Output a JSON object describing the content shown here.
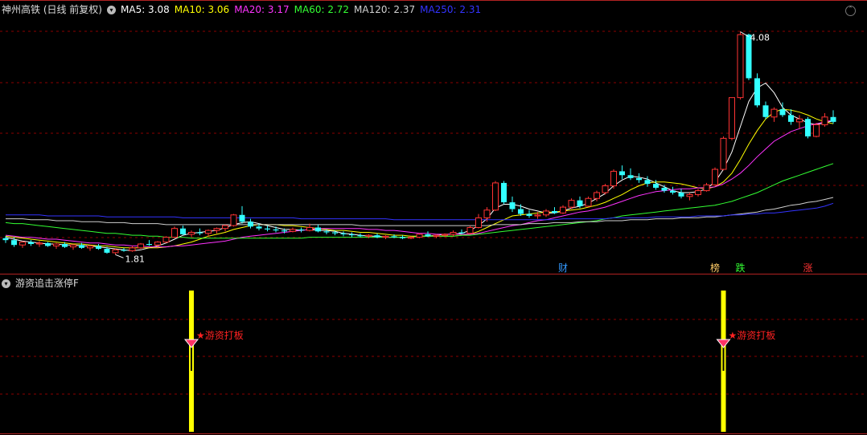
{
  "header": {
    "stock_title": "神州高铁 (日线 前复权)",
    "ma_items": [
      {
        "label": "MA5: 3.08",
        "color": "#ffffff"
      },
      {
        "label": "MA10: 3.06",
        "color": "#ffff00"
      },
      {
        "label": "MA20: 3.17",
        "color": "#ff33ff"
      },
      {
        "label": "MA60: 2.72",
        "color": "#33ff33"
      },
      {
        "label": "MA120: 2.37",
        "color": "#d0d0d0"
      },
      {
        "label": "MA250: 2.31",
        "color": "#3333ff"
      }
    ]
  },
  "sub_header": {
    "indicator_title": "游资追击涨停F"
  },
  "chart_data": {
    "type": "candlestick",
    "ylim": [
      1.65,
      4.2
    ],
    "candles": [
      [
        1.95,
        1.97,
        1.9,
        1.93
      ],
      [
        1.93,
        1.96,
        1.86,
        1.88
      ],
      [
        1.88,
        1.92,
        1.85,
        1.91
      ],
      [
        1.91,
        1.93,
        1.87,
        1.89
      ],
      [
        1.89,
        1.92,
        1.86,
        1.9
      ],
      [
        1.9,
        1.91,
        1.86,
        1.87
      ],
      [
        1.87,
        1.9,
        1.84,
        1.89
      ],
      [
        1.89,
        1.91,
        1.85,
        1.86
      ],
      [
        1.86,
        1.89,
        1.83,
        1.88
      ],
      [
        1.88,
        1.9,
        1.84,
        1.85
      ],
      [
        1.85,
        1.88,
        1.82,
        1.87
      ],
      [
        1.87,
        1.89,
        1.83,
        1.84
      ],
      [
        1.84,
        1.86,
        1.79,
        1.8
      ],
      [
        1.8,
        1.84,
        1.78,
        1.83
      ],
      [
        1.83,
        1.85,
        1.81,
        1.82
      ],
      [
        1.82,
        1.87,
        1.81,
        1.85
      ],
      [
        1.85,
        1.9,
        1.84,
        1.89
      ],
      [
        1.89,
        1.93,
        1.87,
        1.88
      ],
      [
        1.88,
        1.92,
        1.86,
        1.91
      ],
      [
        1.91,
        1.97,
        1.9,
        1.96
      ],
      [
        1.96,
        2.07,
        1.95,
        2.05
      ],
      [
        2.05,
        2.08,
        1.98,
        1.99
      ],
      [
        1.99,
        2.03,
        1.96,
        2.01
      ],
      [
        2.01,
        2.05,
        1.98,
        2.0
      ],
      [
        2.0,
        2.04,
        1.97,
        2.03
      ],
      [
        2.03,
        2.06,
        2.0,
        2.05
      ],
      [
        2.05,
        2.09,
        2.02,
        2.08
      ],
      [
        2.08,
        2.2,
        2.07,
        2.19
      ],
      [
        2.19,
        2.28,
        2.1,
        2.12
      ],
      [
        2.12,
        2.15,
        2.05,
        2.07
      ],
      [
        2.07,
        2.1,
        2.03,
        2.05
      ],
      [
        2.05,
        2.08,
        2.02,
        2.04
      ],
      [
        2.04,
        2.07,
        2.01,
        2.03
      ],
      [
        2.03,
        2.05,
        2.0,
        2.02
      ],
      [
        2.02,
        2.06,
        2.01,
        2.04
      ],
      [
        2.04,
        2.06,
        2.01,
        2.03
      ],
      [
        2.03,
        2.1,
        2.02,
        2.06
      ],
      [
        2.06,
        2.09,
        2.01,
        2.02
      ],
      [
        2.02,
        2.04,
        1.99,
        2.01
      ],
      [
        2.01,
        2.03,
        1.98,
        2.0
      ],
      [
        2.0,
        2.02,
        1.97,
        1.99
      ],
      [
        1.99,
        2.01,
        1.96,
        1.98
      ],
      [
        1.98,
        2.0,
        1.96,
        1.97
      ],
      [
        1.97,
        1.99,
        1.95,
        1.98
      ],
      [
        1.98,
        2.0,
        1.95,
        1.96
      ],
      [
        1.96,
        1.98,
        1.94,
        1.97
      ],
      [
        1.97,
        1.99,
        1.95,
        1.96
      ],
      [
        1.96,
        1.98,
        1.94,
        1.95
      ],
      [
        1.95,
        1.97,
        1.94,
        1.96
      ],
      [
        1.96,
        2.0,
        1.95,
        1.99
      ],
      [
        1.99,
        2.02,
        1.96,
        1.97
      ],
      [
        1.97,
        1.99,
        1.95,
        1.98
      ],
      [
        1.98,
        2.0,
        1.96,
        1.99
      ],
      [
        1.99,
        2.03,
        1.97,
        2.01
      ],
      [
        2.01,
        2.04,
        1.99,
        2.0
      ],
      [
        2.0,
        2.08,
        1.99,
        2.06
      ],
      [
        2.06,
        2.2,
        2.05,
        2.16
      ],
      [
        2.16,
        2.27,
        2.12,
        2.24
      ],
      [
        2.24,
        2.54,
        2.23,
        2.52
      ],
      [
        2.52,
        2.54,
        2.3,
        2.32
      ],
      [
        2.32,
        2.38,
        2.22,
        2.25
      ],
      [
        2.25,
        2.3,
        2.18,
        2.2
      ],
      [
        2.2,
        2.24,
        2.16,
        2.18
      ],
      [
        2.18,
        2.22,
        2.15,
        2.19
      ],
      [
        2.19,
        2.25,
        2.17,
        2.23
      ],
      [
        2.23,
        2.27,
        2.2,
        2.21
      ],
      [
        2.21,
        2.29,
        2.2,
        2.27
      ],
      [
        2.27,
        2.36,
        2.25,
        2.34
      ],
      [
        2.34,
        2.38,
        2.26,
        2.28
      ],
      [
        2.28,
        2.38,
        2.27,
        2.36
      ],
      [
        2.36,
        2.44,
        2.33,
        2.42
      ],
      [
        2.42,
        2.51,
        2.4,
        2.49
      ],
      [
        2.49,
        2.66,
        2.46,
        2.64
      ],
      [
        2.64,
        2.7,
        2.56,
        2.6
      ],
      [
        2.6,
        2.67,
        2.55,
        2.57
      ],
      [
        2.57,
        2.62,
        2.52,
        2.55
      ],
      [
        2.55,
        2.59,
        2.48,
        2.51
      ],
      [
        2.51,
        2.55,
        2.45,
        2.47
      ],
      [
        2.47,
        2.5,
        2.42,
        2.44
      ],
      [
        2.44,
        2.48,
        2.4,
        2.42
      ],
      [
        2.42,
        2.46,
        2.36,
        2.38
      ],
      [
        2.38,
        2.42,
        2.34,
        2.4
      ],
      [
        2.4,
        2.46,
        2.38,
        2.44
      ],
      [
        2.44,
        2.52,
        2.43,
        2.5
      ],
      [
        2.5,
        2.68,
        2.49,
        2.66
      ],
      [
        2.66,
        3.0,
        2.65,
        2.98
      ],
      [
        2.98,
        3.1,
        2.96,
        3.4
      ],
      [
        3.4,
        4.08,
        3.38,
        4.05
      ],
      [
        4.05,
        4.06,
        3.58,
        3.6
      ],
      [
        3.6,
        3.65,
        3.3,
        3.32
      ],
      [
        3.32,
        3.36,
        3.18,
        3.2
      ],
      [
        3.2,
        3.3,
        3.15,
        3.28
      ],
      [
        3.28,
        3.35,
        3.2,
        3.22
      ],
      [
        3.22,
        3.28,
        3.12,
        3.15
      ],
      [
        3.15,
        3.22,
        3.08,
        3.18
      ],
      [
        3.18,
        3.2,
        2.98,
        3.0
      ],
      [
        3.0,
        3.14,
        2.99,
        3.12
      ],
      [
        3.12,
        3.24,
        3.1,
        3.2
      ],
      [
        3.2,
        3.27,
        3.13,
        3.15
      ]
    ],
    "ma": [
      {
        "name": "MA5",
        "color": "#ffffff",
        "values": [
          1.96,
          1.94,
          1.92,
          1.91,
          1.9,
          1.89,
          1.89,
          1.88,
          1.88,
          1.87,
          1.87,
          1.86,
          1.85,
          1.84,
          1.83,
          1.82,
          1.83,
          1.85,
          1.87,
          1.9,
          1.94,
          1.98,
          2.0,
          2.01,
          2.02,
          2.03,
          2.06,
          2.09,
          2.11,
          2.12,
          2.1,
          2.08,
          2.06,
          2.04,
          2.04,
          2.03,
          2.04,
          2.03,
          2.03,
          2.02,
          2.0,
          1.99,
          1.98,
          1.97,
          1.97,
          1.96,
          1.96,
          1.96,
          1.96,
          1.97,
          1.97,
          1.98,
          1.99,
          1.99,
          2.0,
          2.03,
          2.08,
          2.15,
          2.26,
          2.3,
          2.3,
          2.28,
          2.25,
          2.23,
          2.21,
          2.21,
          2.23,
          2.26,
          2.28,
          2.31,
          2.36,
          2.41,
          2.49,
          2.55,
          2.59,
          2.58,
          2.56,
          2.52,
          2.48,
          2.44,
          2.42,
          2.42,
          2.43,
          2.46,
          2.53,
          2.66,
          2.84,
          3.1,
          3.36,
          3.5,
          3.55,
          3.45,
          3.3,
          3.22,
          3.18,
          3.14,
          3.12,
          3.14,
          3.16
        ]
      },
      {
        "name": "MA10",
        "color": "#ffff00",
        "values": [
          1.97,
          1.96,
          1.95,
          1.94,
          1.93,
          1.92,
          1.91,
          1.9,
          1.89,
          1.89,
          1.88,
          1.87,
          1.87,
          1.86,
          1.85,
          1.85,
          1.85,
          1.85,
          1.85,
          1.86,
          1.87,
          1.89,
          1.91,
          1.94,
          1.97,
          1.99,
          2.01,
          2.04,
          2.06,
          2.08,
          2.09,
          2.09,
          2.09,
          2.08,
          2.08,
          2.07,
          2.06,
          2.05,
          2.04,
          2.03,
          2.03,
          2.02,
          2.01,
          2.01,
          2.0,
          1.99,
          1.98,
          1.98,
          1.97,
          1.97,
          1.97,
          1.97,
          1.97,
          1.97,
          1.98,
          1.99,
          2.02,
          2.06,
          2.1,
          2.14,
          2.18,
          2.19,
          2.2,
          2.21,
          2.22,
          2.22,
          2.23,
          2.24,
          2.25,
          2.27,
          2.29,
          2.32,
          2.36,
          2.4,
          2.45,
          2.49,
          2.52,
          2.53,
          2.53,
          2.52,
          2.51,
          2.49,
          2.47,
          2.46,
          2.48,
          2.53,
          2.62,
          2.76,
          2.92,
          3.06,
          3.18,
          3.25,
          3.28,
          3.27,
          3.25,
          3.22,
          3.18,
          3.15,
          3.13
        ]
      },
      {
        "name": "MA20",
        "color": "#ff33ff",
        "values": [
          1.98,
          1.97,
          1.96,
          1.96,
          1.95,
          1.94,
          1.94,
          1.93,
          1.92,
          1.91,
          1.9,
          1.9,
          1.89,
          1.88,
          1.88,
          1.87,
          1.87,
          1.86,
          1.86,
          1.86,
          1.87,
          1.87,
          1.88,
          1.89,
          1.9,
          1.91,
          1.92,
          1.94,
          1.96,
          1.97,
          1.98,
          1.99,
          2.0,
          2.01,
          2.02,
          2.03,
          2.04,
          2.05,
          2.05,
          2.05,
          2.05,
          2.05,
          2.05,
          2.04,
          2.04,
          2.03,
          2.03,
          2.02,
          2.01,
          2.0,
          2.0,
          1.99,
          1.99,
          1.99,
          1.99,
          1.99,
          2.0,
          2.02,
          2.04,
          2.06,
          2.08,
          2.09,
          2.11,
          2.13,
          2.14,
          2.16,
          2.18,
          2.2,
          2.22,
          2.23,
          2.25,
          2.27,
          2.3,
          2.33,
          2.36,
          2.39,
          2.41,
          2.43,
          2.44,
          2.45,
          2.46,
          2.46,
          2.47,
          2.47,
          2.48,
          2.51,
          2.56,
          2.62,
          2.7,
          2.79,
          2.87,
          2.95,
          3.0,
          3.05,
          3.08,
          3.11,
          3.13,
          3.15,
          3.17
        ]
      },
      {
        "name": "MA60",
        "color": "#33ff33",
        "values": [
          2.11,
          2.1,
          2.1,
          2.09,
          2.08,
          2.07,
          2.06,
          2.05,
          2.04,
          2.03,
          2.02,
          2.01,
          2.0,
          2.0,
          1.99,
          1.98,
          1.98,
          1.97,
          1.97,
          1.96,
          1.96,
          1.96,
          1.95,
          1.95,
          1.95,
          1.95,
          1.95,
          1.95,
          1.95,
          1.95,
          1.95,
          1.95,
          1.95,
          1.95,
          1.95,
          1.95,
          1.96,
          1.96,
          1.96,
          1.96,
          1.96,
          1.96,
          1.96,
          1.96,
          1.96,
          1.96,
          1.96,
          1.96,
          1.96,
          1.97,
          1.97,
          1.97,
          1.97,
          1.97,
          1.98,
          1.98,
          1.99,
          2.0,
          2.01,
          2.02,
          2.03,
          2.04,
          2.05,
          2.06,
          2.07,
          2.08,
          2.09,
          2.1,
          2.11,
          2.12,
          2.13,
          2.15,
          2.16,
          2.18,
          2.19,
          2.2,
          2.21,
          2.22,
          2.23,
          2.24,
          2.25,
          2.26,
          2.27,
          2.28,
          2.29,
          2.31,
          2.33,
          2.36,
          2.39,
          2.42,
          2.46,
          2.5,
          2.54,
          2.57,
          2.6,
          2.63,
          2.66,
          2.69,
          2.72
        ]
      },
      {
        "name": "MA120",
        "color": "#d0d0d0",
        "values": [
          2.15,
          2.15,
          2.15,
          2.14,
          2.14,
          2.14,
          2.13,
          2.13,
          2.13,
          2.12,
          2.12,
          2.12,
          2.11,
          2.11,
          2.11,
          2.1,
          2.1,
          2.1,
          2.1,
          2.09,
          2.09,
          2.09,
          2.09,
          2.09,
          2.09,
          2.09,
          2.09,
          2.09,
          2.09,
          2.09,
          2.09,
          2.09,
          2.09,
          2.09,
          2.09,
          2.09,
          2.09,
          2.09,
          2.09,
          2.09,
          2.09,
          2.09,
          2.08,
          2.08,
          2.08,
          2.08,
          2.08,
          2.08,
          2.08,
          2.08,
          2.08,
          2.08,
          2.08,
          2.08,
          2.08,
          2.08,
          2.08,
          2.08,
          2.09,
          2.09,
          2.09,
          2.09,
          2.1,
          2.1,
          2.1,
          2.11,
          2.11,
          2.11,
          2.12,
          2.12,
          2.12,
          2.13,
          2.13,
          2.13,
          2.14,
          2.14,
          2.14,
          2.15,
          2.15,
          2.15,
          2.16,
          2.16,
          2.16,
          2.17,
          2.17,
          2.18,
          2.19,
          2.2,
          2.21,
          2.22,
          2.24,
          2.25,
          2.27,
          2.29,
          2.3,
          2.32,
          2.33,
          2.35,
          2.37
        ]
      },
      {
        "name": "MA250",
        "color": "#3333ff",
        "values": [
          2.19,
          2.19,
          2.19,
          2.19,
          2.19,
          2.18,
          2.18,
          2.18,
          2.18,
          2.18,
          2.18,
          2.18,
          2.17,
          2.17,
          2.17,
          2.17,
          2.17,
          2.17,
          2.17,
          2.17,
          2.17,
          2.16,
          2.16,
          2.16,
          2.16,
          2.16,
          2.16,
          2.16,
          2.16,
          2.16,
          2.16,
          2.16,
          2.16,
          2.16,
          2.16,
          2.15,
          2.15,
          2.15,
          2.15,
          2.15,
          2.15,
          2.15,
          2.15,
          2.15,
          2.15,
          2.15,
          2.14,
          2.14,
          2.14,
          2.14,
          2.14,
          2.14,
          2.14,
          2.14,
          2.14,
          2.14,
          2.14,
          2.14,
          2.14,
          2.14,
          2.14,
          2.14,
          2.14,
          2.14,
          2.14,
          2.14,
          2.15,
          2.15,
          2.15,
          2.15,
          2.15,
          2.15,
          2.16,
          2.16,
          2.16,
          2.16,
          2.16,
          2.17,
          2.17,
          2.17,
          2.17,
          2.17,
          2.18,
          2.18,
          2.18,
          2.18,
          2.19,
          2.19,
          2.2,
          2.2,
          2.21,
          2.21,
          2.22,
          2.23,
          2.24,
          2.25,
          2.26,
          2.28,
          2.31
        ]
      }
    ],
    "annotations": [
      {
        "label": "1.81",
        "candle_index": 13,
        "price": 1.78,
        "color": "#ffffff"
      },
      {
        "label": "4.08",
        "candle_index": 87,
        "price": 4.08,
        "color": "#ffffff"
      }
    ],
    "event_markers": [
      {
        "label": "财",
        "candle_index": 66,
        "color": "#3399ff"
      },
      {
        "label": "榜",
        "candle_index": 84,
        "color": "#ffcc66"
      },
      {
        "label": "跌",
        "candle_index": 87,
        "color": "#33ff33"
      },
      {
        "label": "涨",
        "candle_index": 95,
        "color": "#ff3333"
      }
    ],
    "signals": [
      {
        "label": "★游资打板",
        "candle_index": 22,
        "color": "#ff2222"
      },
      {
        "label": "★游资打板",
        "candle_index": 85,
        "color": "#ff2222"
      }
    ],
    "colors": {
      "up": "#ff3333",
      "down": "#33ffff",
      "signal_bar": "#ffff00",
      "grid": "#8b0000",
      "separator": "#b22222"
    }
  }
}
